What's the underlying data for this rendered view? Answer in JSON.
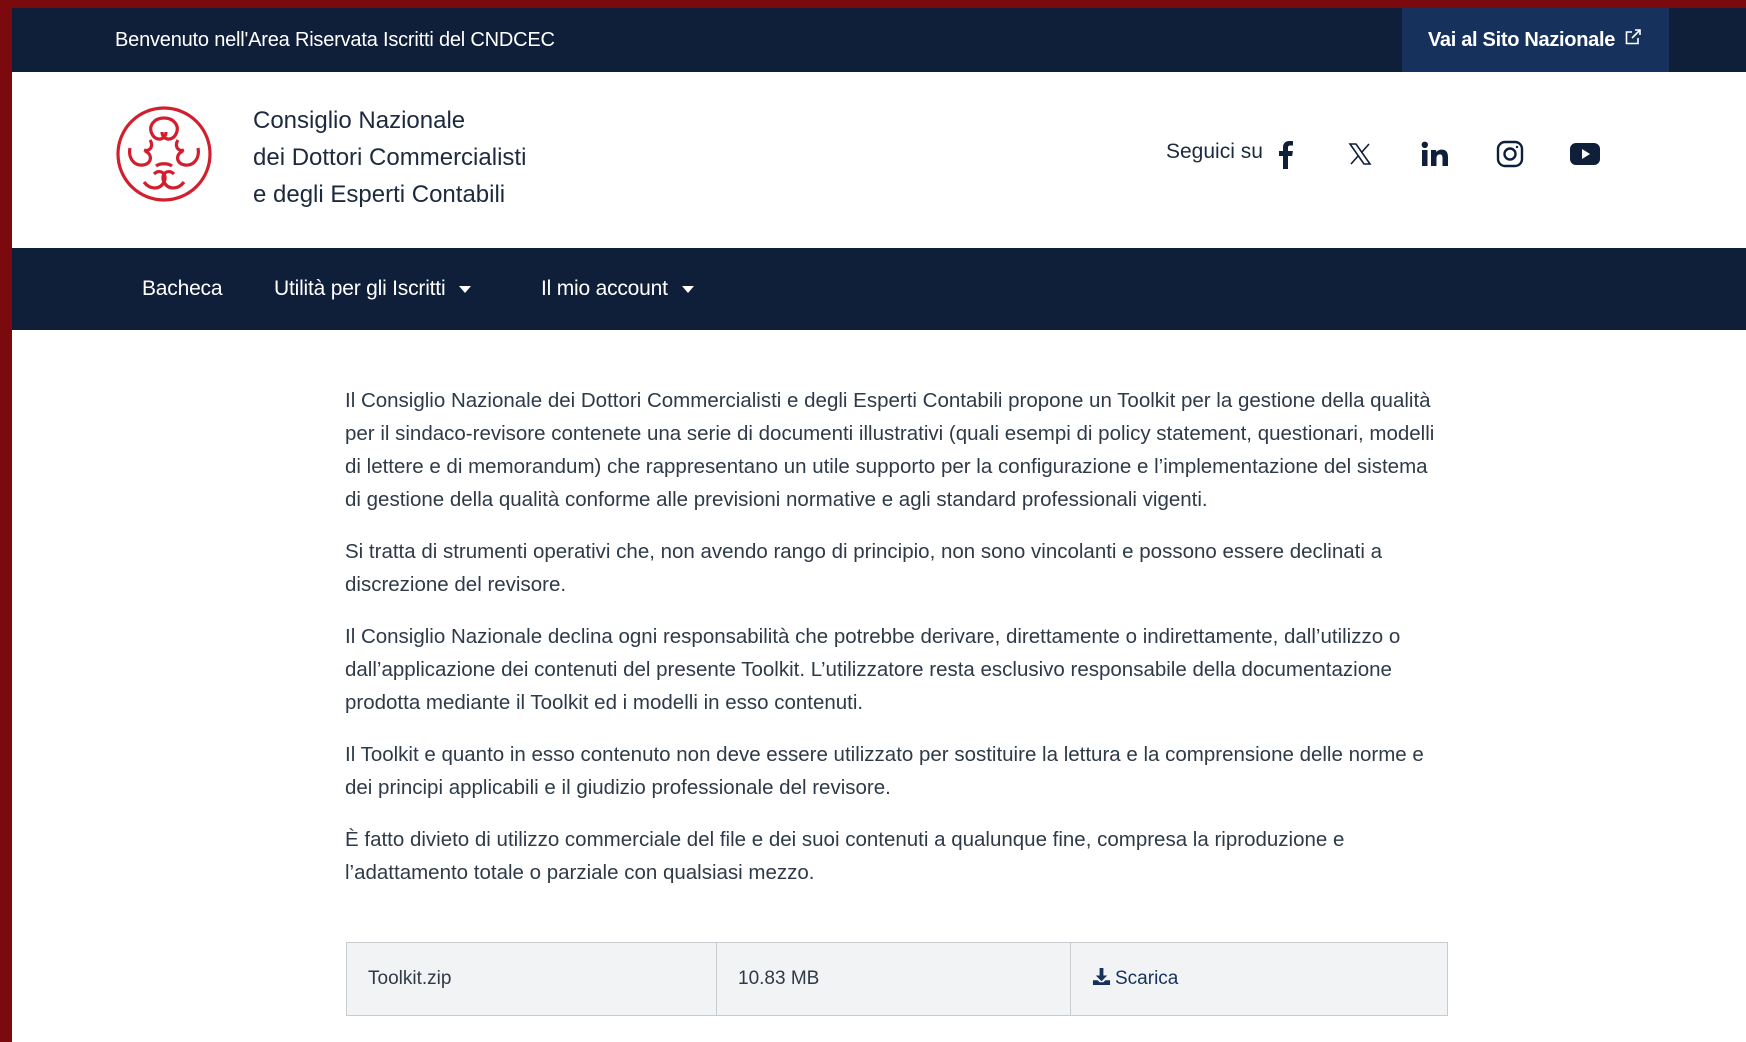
{
  "topbar": {
    "welcome": "Benvenuto nell'Area Riservata Iscritti del CNDCEC",
    "national_link": "Vai al Sito Nazionale"
  },
  "header": {
    "org_line1": "Consiglio Nazionale",
    "org_line2": "dei Dottori Commercialisti",
    "org_line3": "e degli Esperti Contabili",
    "follow_label": "Seguici su",
    "social": [
      "facebook-icon",
      "x-icon",
      "linkedin-icon",
      "instagram-icon",
      "youtube-icon"
    ]
  },
  "nav": {
    "items": [
      {
        "label": "Bacheca"
      },
      {
        "label": "Utilità per gli Iscritti"
      },
      {
        "label": "Il mio account"
      }
    ]
  },
  "content": {
    "paragraphs": [
      "Il Consiglio Nazionale dei Dottori Commercialisti e degli Esperti Contabili propone un Toolkit per la gestione della qualità per il sindaco-revisore contenete una serie di documenti illustrativi (quali esempi di policy statement, questionari, modelli di lettere e di memorandum) che rappresentano un utile supporto per la configurazione e l’implementazione del sistema di gestione della qualità conforme alle previsioni normative e agli standard professionali vigenti.",
      "Si tratta di strumenti operativi che, non avendo rango di principio, non sono vincolanti e possono essere declinati a discrezione del revisore.",
      "Il Consiglio Nazionale declina ogni responsabilità che potrebbe derivare, direttamente o indirettamente, dall’utilizzo o dall’applicazione dei contenuti del presente Toolkit. L’utilizzatore resta esclusivo responsabile della documentazione prodotta mediante il Toolkit ed i modelli in esso contenuti.",
      "Il Toolkit e quanto in esso contenuto non deve essere utilizzato per sostituire la lettura e la comprensione delle norme e dei principi applicabili e il giudizio professionale del revisore.",
      "È fatto divieto di utilizzo commerciale del file e dei suoi contenuti a qualunque fine, compresa la riproduzione e l’adattamento totale o parziale con qualsiasi mezzo."
    ]
  },
  "download": {
    "filename": "Toolkit.zip",
    "size": "10.83 MB",
    "action": "Scarica"
  },
  "colors": {
    "navy": "#0f1f3a",
    "accent_blue": "#16325c",
    "logo_red": "#d11f2e",
    "frame_red": "#7a0a0e"
  }
}
